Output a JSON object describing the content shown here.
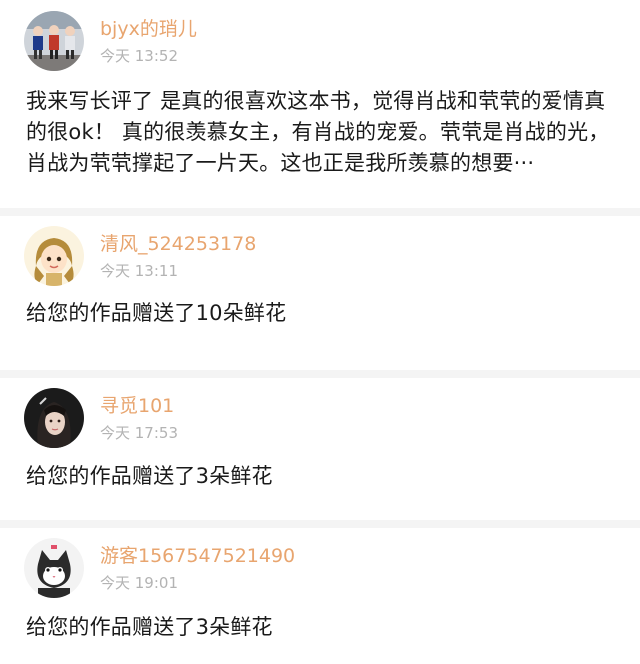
{
  "comments": [
    {
      "name": "bjyx的琑儿",
      "time": "今天 13:52",
      "text": "我来写长评了 是真的很喜欢这本书，觉得肖战和茕茕的爱情真的很ok！ 真的很羡慕女主，有肖战的宠爱。茕茕是肖战的光，肖战为茕茕撑起了一片天。这也正是我所羡慕的想要···"
    },
    {
      "name": "清风_524253178",
      "time": "今天 13:11",
      "text": "给您的作品赠送了10朵鲜花"
    },
    {
      "name": "寻觅101",
      "time": "今天 17:53",
      "text": "给您的作品赠送了3朵鲜花"
    },
    {
      "name": "游客1567547521490",
      "time": "今天 19:01",
      "text": "给您的作品赠送了3朵鲜花"
    }
  ],
  "colors": {
    "name": "#e8a56f",
    "time": "#b3b3b3",
    "text": "#1a1a1a",
    "separator": "#f4f4f4"
  }
}
